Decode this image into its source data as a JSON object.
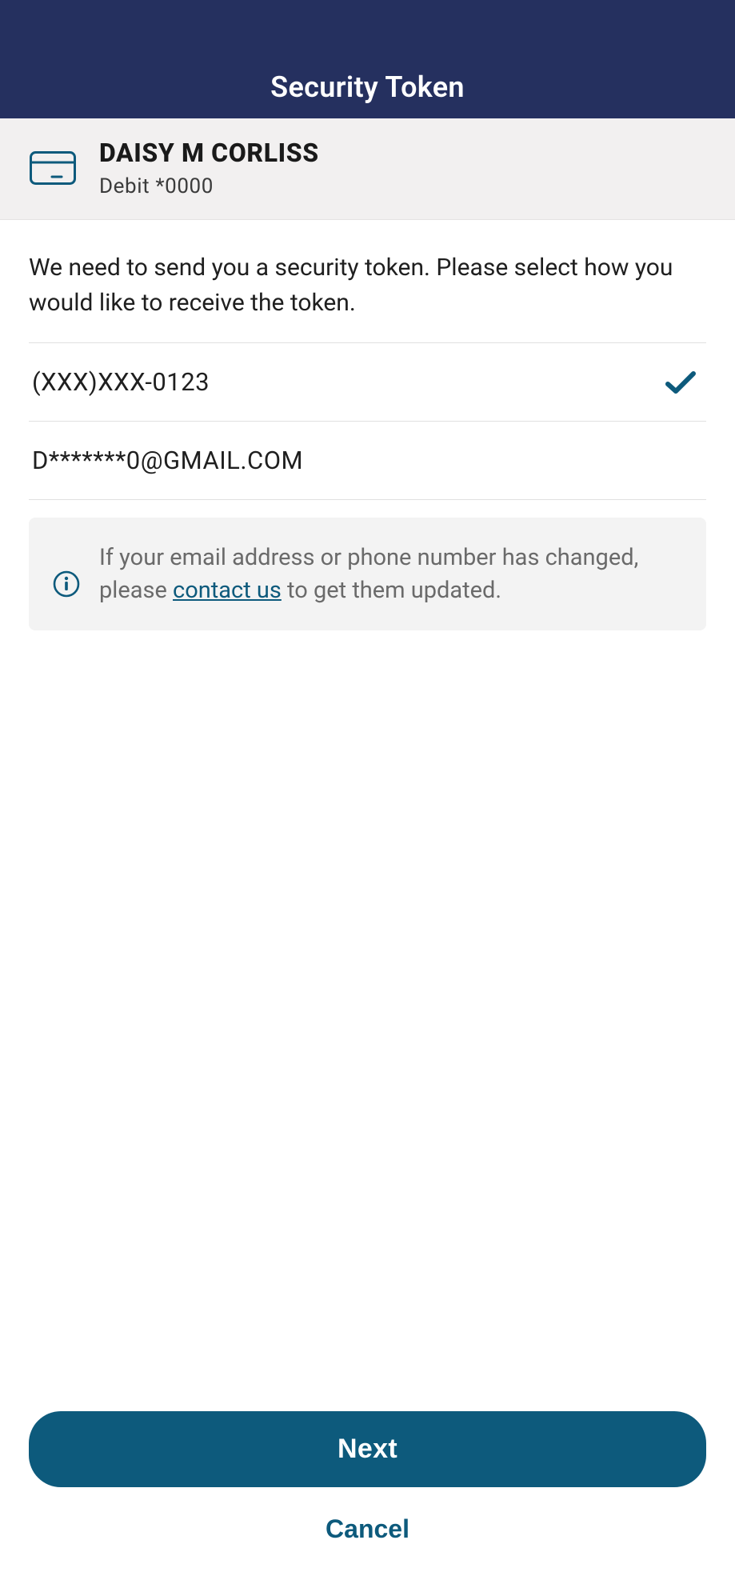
{
  "header": {
    "title": "Security Token"
  },
  "account": {
    "name": "DAISY M CORLISS",
    "subtitle": "Debit *0000"
  },
  "intro": "We need to send you a security token. Please select how you would like to receive the token.",
  "options": [
    {
      "label": "(XXX)XXX-0123",
      "selected": true
    },
    {
      "label": "D*******0@GMAIL.COM",
      "selected": false
    }
  ],
  "info": {
    "pre": "If your email address or phone number has changed, please ",
    "link": "contact us",
    "post": " to get them updated."
  },
  "buttons": {
    "primary": "Next",
    "cancel": "Cancel"
  },
  "colors": {
    "headerBg": "#25305f",
    "accent": "#0d5a7c"
  }
}
